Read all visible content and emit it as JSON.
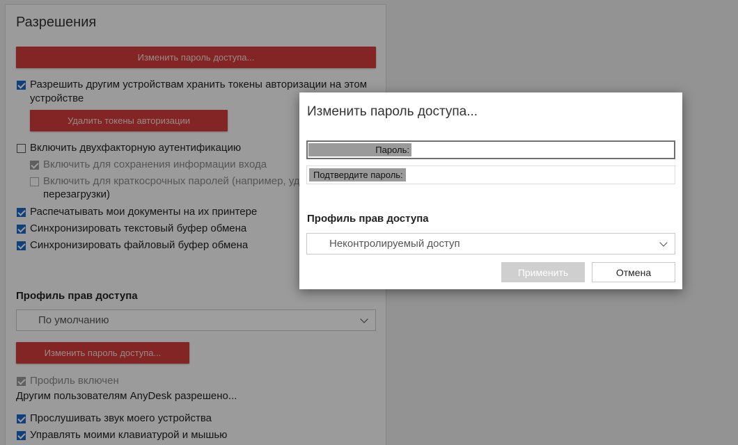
{
  "panel": {
    "title": "Разрешения",
    "change_password_top": "Изменить пароль доступа...",
    "allow_tokens": "Разрешить другим устройствам хранить токены авторизации на этом устройстве",
    "delete_tokens": "Удалить токены авторизации",
    "two_factor": "Включить двухфакторную аутентификацию",
    "two_factor_login": "Включить для сохранения информации входа",
    "two_factor_short": "Включить для краткосрочных паролей (например, уд",
    "two_factor_short_2": "перезагрузки)",
    "print_docs": "Распечатывать мои документы на их принтере",
    "sync_text": "Синхронизировать текстовый буфер обмена",
    "sync_files": "Синхронизировать файловый буфер обмена",
    "profile_section": "Профиль прав доступа",
    "profile_value": "По умолчанию",
    "change_password_bottom": "Изменить пароль доступа...",
    "profile_enabled": "Профиль включен",
    "allowed_text": "Другим пользователям AnyDesk разрешено...",
    "listen_audio": "Прослушивать звук моего устройства",
    "control_kbd": "Управлять моими клавиатурой и мышью"
  },
  "dialog": {
    "title": "Изменить пароль доступа...",
    "password_label": "Пароль:",
    "confirm_label": "Подтвердите пароль:",
    "profile_section": "Профиль прав доступа",
    "profile_value": "Неконтролируемый доступ",
    "apply": "Применить",
    "cancel": "Отмена"
  },
  "colors": {
    "accent_red": "#d23c3a",
    "checkbox_blue": "#1b6ac9"
  }
}
